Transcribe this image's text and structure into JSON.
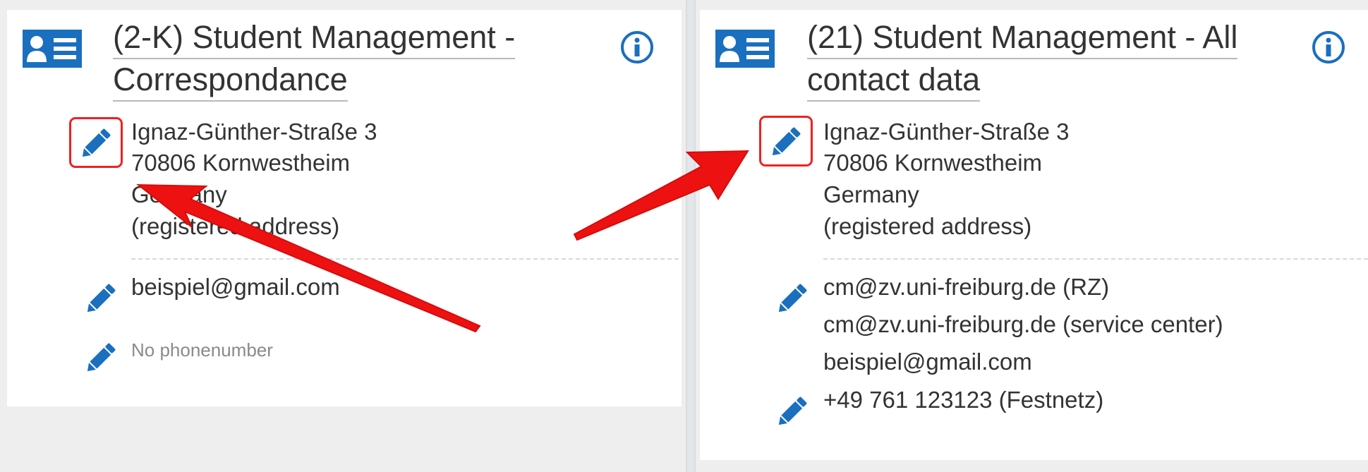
{
  "colors": {
    "accent": "#1a6fbf",
    "arrow": "#ee1111",
    "highlight": "#ee2222",
    "muted": "#8a8a8a"
  },
  "left_card": {
    "icon": "contact-card-icon",
    "title_line1": "(2-K) Student Management -",
    "title_line2": "Correspondance",
    "info_icon": "info-icon",
    "address": {
      "line1": "Ignaz-Günther-Straße 3",
      "line2": "70806 Kornwestheim",
      "line3": "Germany",
      "line4": "(registered address)"
    },
    "email": "beispiel@gmail.com",
    "phone": "No phonenumber"
  },
  "right_card": {
    "icon": "contact-card-icon",
    "title_line1": "(21) Student Management - All",
    "title_line2": "contact data",
    "info_icon": "info-icon",
    "address": {
      "line1": "Ignaz-Günther-Straße 3",
      "line2": "70806 Kornwestheim",
      "line3": "Germany",
      "line4": "(registered address)"
    },
    "emails": [
      "cm@zv.uni-freiburg.de (RZ)",
      "cm@zv.uni-freiburg.de (service center)",
      "beispiel@gmail.com"
    ],
    "phone": "+49 761 123123 (Festnetz)"
  }
}
